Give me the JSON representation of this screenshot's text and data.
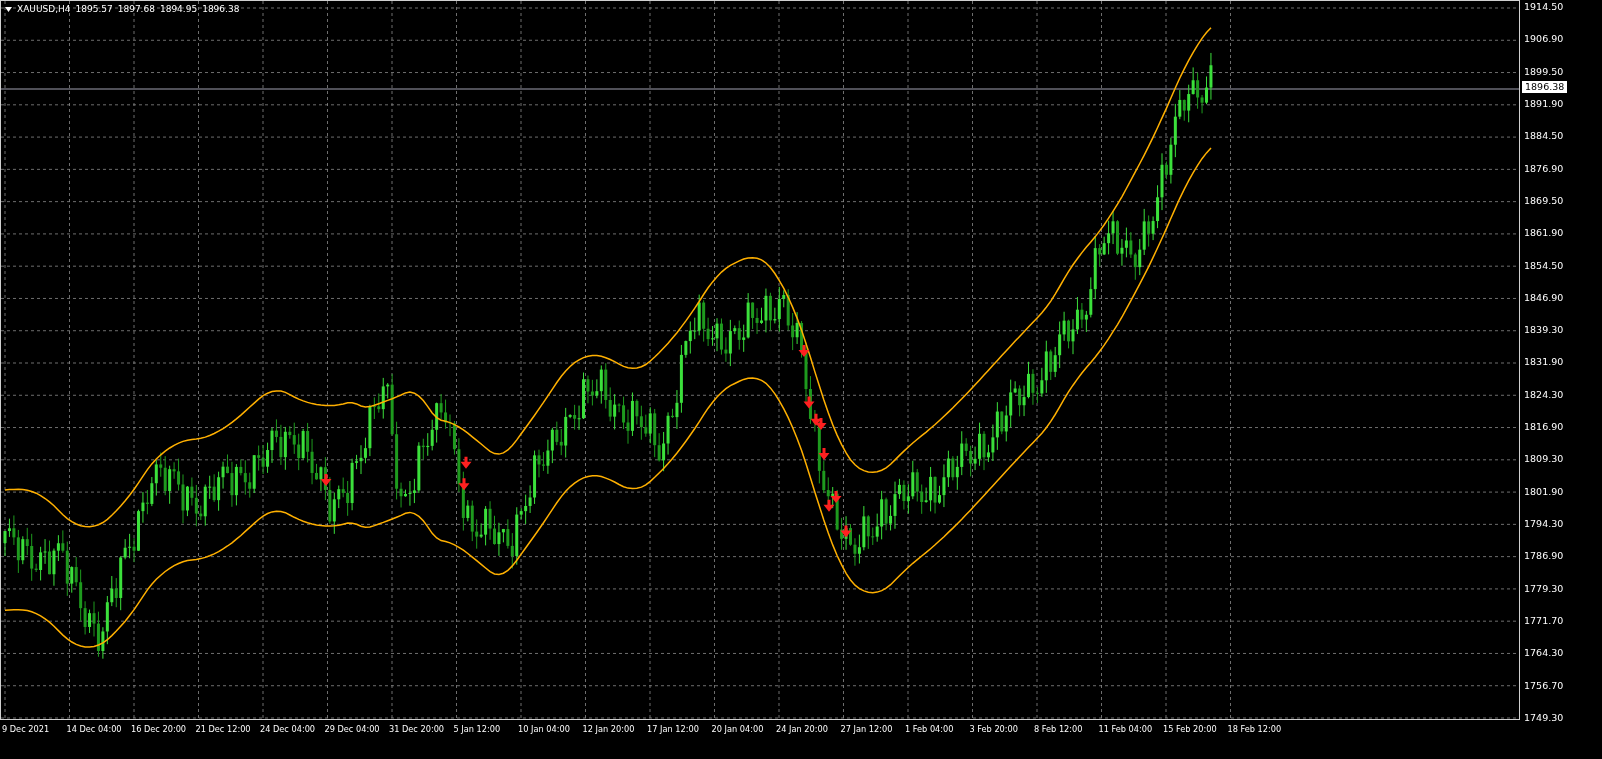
{
  "chart": {
    "symbol": "XAUUSD,H4",
    "ohlc": [
      "1895.57",
      "1897.68",
      "1894.95",
      "1896.38"
    ]
  },
  "price_axis": {
    "labels": [
      "1914.50",
      "1906.90",
      "1899.50",
      "1891.90",
      "1884.50",
      "1876.90",
      "1869.50",
      "1861.90",
      "1854.50",
      "1846.90",
      "1839.30",
      "1831.90",
      "1824.30",
      "1816.90",
      "1809.30",
      "1801.90",
      "1794.30",
      "1786.90",
      "1779.30",
      "1771.70",
      "1764.30",
      "1756.70",
      "1749.30"
    ],
    "current_price": "1896.38"
  },
  "time_axis": {
    "labels": [
      "9 Dec 2021",
      "14 Dec 04:00",
      "16 Dec 20:00",
      "21 Dec 12:00",
      "24 Dec 04:00",
      "29 Dec 04:00",
      "31 Dec 20:00",
      "5 Jan 12:00",
      "10 Jan 04:00",
      "12 Jan 20:00",
      "17 Jan 12:00",
      "20 Jan 04:00",
      "24 Jan 20:00",
      "27 Jan 12:00",
      "1 Feb 04:00",
      "3 Feb 20:00",
      "8 Feb 12:00",
      "11 Feb 04:00",
      "15 Feb 20:00",
      "18 Feb 12:00"
    ]
  }
}
